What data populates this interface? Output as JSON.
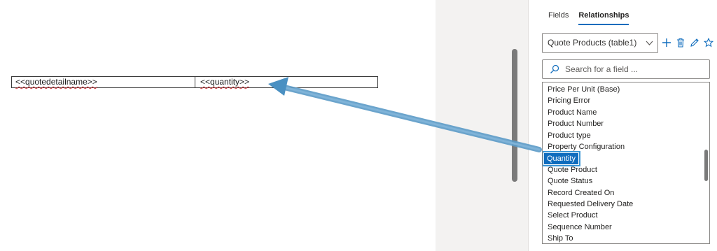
{
  "document": {
    "table": {
      "cells": [
        "<<quotedetailname>>",
        "<<quantity>>"
      ]
    }
  },
  "panel": {
    "tabs": [
      {
        "label": "Fields",
        "active": false
      },
      {
        "label": "Relationships",
        "active": true
      }
    ],
    "table_select": {
      "value": "Quote Products (table1)"
    },
    "actions": [
      "add-icon",
      "delete-icon",
      "edit-icon",
      "favorite-icon"
    ],
    "search": {
      "placeholder": "Search for a field ...",
      "value": ""
    },
    "fields": [
      {
        "label": "Price Per Unit (Base)"
      },
      {
        "label": "Pricing Error"
      },
      {
        "label": "Product Name"
      },
      {
        "label": "Product Number"
      },
      {
        "label": "Product type"
      },
      {
        "label": "Property Configuration"
      },
      {
        "label": "Quantity",
        "selected": true
      },
      {
        "label": "Quote Product"
      },
      {
        "label": "Quote Status"
      },
      {
        "label": "Record Created On"
      },
      {
        "label": "Requested Delivery Date"
      },
      {
        "label": "Select Product"
      },
      {
        "label": "Sequence Number"
      },
      {
        "label": "Ship To"
      }
    ]
  },
  "colors": {
    "accent": "#0f6cbd",
    "annotation_arrow": "#4a90c2",
    "gutter": "#f3f2f1"
  }
}
